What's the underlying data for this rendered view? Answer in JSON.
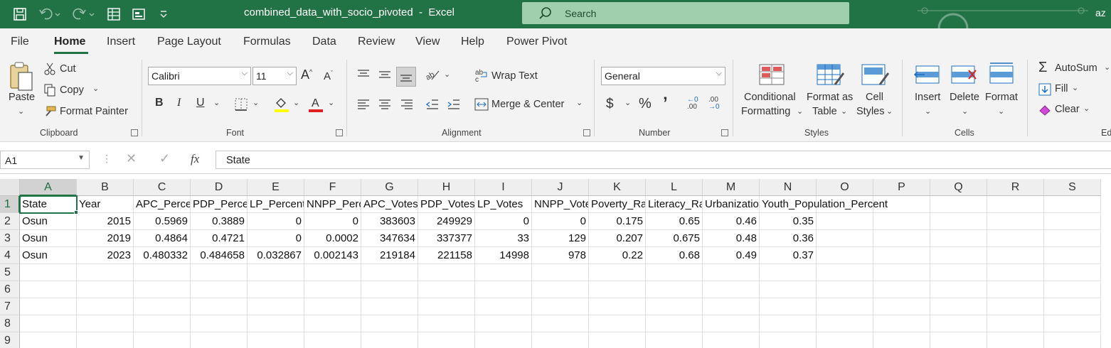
{
  "window": {
    "title": "combined_data_with_socio_pivoted  -  Excel",
    "search_placeholder": "Search",
    "user_initials": "az"
  },
  "tabs": [
    "File",
    "Home",
    "Insert",
    "Page Layout",
    "Formulas",
    "Data",
    "Review",
    "View",
    "Help",
    "Power Pivot"
  ],
  "ribbon": {
    "clipboard": {
      "paste": "Paste",
      "cut": "Cut",
      "copy": "Copy",
      "format_painter": "Format Painter",
      "label": "Clipboard"
    },
    "font": {
      "name": "Calibri",
      "size": "11",
      "bold": "B",
      "italic": "I",
      "underline": "U",
      "label": "Font"
    },
    "alignment": {
      "wrap_text": "Wrap Text",
      "merge_center": "Merge & Center",
      "label": "Alignment"
    },
    "number": {
      "format": "General",
      "label": "Number"
    },
    "styles": {
      "conditional_1": "Conditional",
      "conditional_2": "Formatting",
      "format_table_1": "Format as",
      "format_table_2": "Table",
      "cell_styles_1": "Cell",
      "cell_styles_2": "Styles",
      "label": "Styles"
    },
    "cells": {
      "insert": "Insert",
      "delete": "Delete",
      "format": "Format",
      "label": "Cells"
    },
    "editing": {
      "autosum": "AutoSum",
      "fill": "Fill",
      "clear": "Clear",
      "label": "Ed"
    }
  },
  "formula_bar": {
    "name_box": "A1",
    "fx": "fx",
    "content": "State"
  },
  "sheet": {
    "columns": [
      "A",
      "B",
      "C",
      "D",
      "E",
      "F",
      "G",
      "H",
      "I",
      "J",
      "K",
      "L",
      "M",
      "N",
      "O",
      "P",
      "Q",
      "R",
      "S"
    ],
    "rows": [
      "1",
      "2",
      "3",
      "4",
      "5",
      "6",
      "7",
      "8",
      "9"
    ],
    "cells": [
      [
        "State",
        "Year",
        "APC_Percent",
        "PDP_Percent",
        "LP_Percent",
        "NNPP_Percent",
        "APC_Votes",
        "PDP_Votes",
        "LP_Votes",
        "NNPP_Votes",
        "Poverty_Rate",
        "Literacy_Rate",
        "Urbanization_Rate",
        "Youth_Population_Percent"
      ],
      [
        "Osun",
        "2015",
        "0.5969",
        "0.3889",
        "0",
        "0",
        "383603",
        "249929",
        "0",
        "0",
        "0.175",
        "0.65",
        "0.46",
        "0.35"
      ],
      [
        "Osun",
        "2019",
        "0.4864",
        "0.4721",
        "0",
        "0.0002",
        "347634",
        "337377",
        "33",
        "129",
        "0.207",
        "0.675",
        "0.48",
        "0.36"
      ],
      [
        "Osun",
        "2023",
        "0.480332",
        "0.484658",
        "0.032867",
        "0.002143",
        "219184",
        "221158",
        "14998",
        "978",
        "0.22",
        "0.68",
        "0.49",
        "0.37"
      ]
    ]
  }
}
